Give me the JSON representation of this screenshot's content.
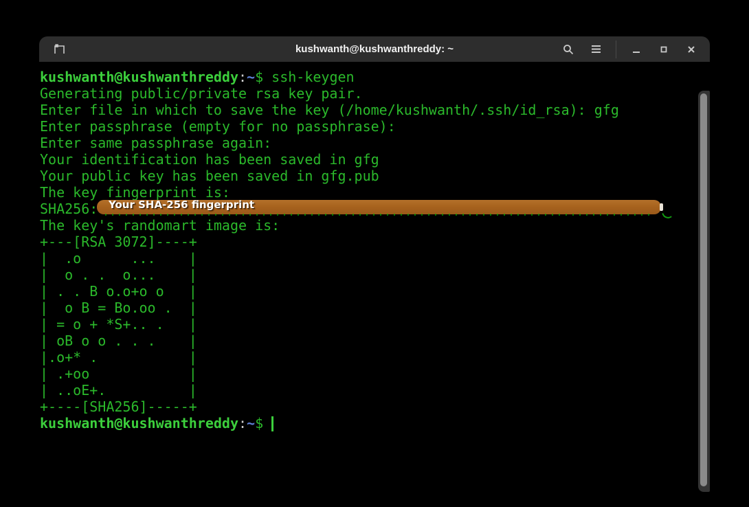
{
  "colors": {
    "background": "#000000",
    "titlebar": "#2d2d2d",
    "title_text": "#f1f1f1",
    "icon": "#c9c9c9",
    "green": "#2bb92b",
    "prompt_green": "#3ccf3c",
    "path_blue": "#5e80d6",
    "plain": "#cdcdcd",
    "redaction_orange": "#a8631e",
    "redaction_text": "#ffffff",
    "scrollbar_thumb": "#8a8a8a",
    "cursor": "#3ccf3c"
  },
  "titlebar": {
    "title": "kushwanth@kushwanthreddy: ~",
    "icon_names": [
      "new-tab-icon",
      "search-icon",
      "menu-icon",
      "minimize-icon",
      "maximize-icon",
      "close-icon"
    ]
  },
  "overlay": {
    "label": "Your SHA-256 fingerprint"
  },
  "terminal": {
    "lines": [
      {
        "segments": [
          {
            "t": "kushwanth@kushwanthreddy",
            "c": "user"
          },
          {
            "t": ":",
            "c": "plain"
          },
          {
            "t": "~",
            "c": "path"
          },
          {
            "t": "$ ",
            "c": "green"
          },
          {
            "t": "ssh-keygen",
            "c": "green"
          }
        ]
      },
      {
        "segments": [
          {
            "t": "Generating public/private rsa key pair.",
            "c": "green"
          }
        ]
      },
      {
        "segments": [
          {
            "t": "Enter file in which to save the key (/home/kushwanth/.ssh/id_rsa): gfg",
            "c": "green"
          }
        ]
      },
      {
        "segments": [
          {
            "t": "Enter passphrase (empty for no passphrase):",
            "c": "green"
          }
        ]
      },
      {
        "segments": [
          {
            "t": "Enter same passphrase again:",
            "c": "green"
          }
        ]
      },
      {
        "segments": [
          {
            "t": "Your identification has been saved in gfg",
            "c": "green"
          }
        ]
      },
      {
        "segments": [
          {
            "t": "Your public key has been saved in gfg.pub",
            "c": "green"
          }
        ]
      },
      {
        "segments": [
          {
            "t": "The key fingerprint is:",
            "c": "green"
          }
        ]
      },
      {
        "segments": [
          {
            "t": "SHA256:",
            "c": "green"
          }
        ]
      },
      {
        "segments": [
          {
            "t": "The key's randomart image is:",
            "c": "green"
          }
        ]
      },
      {
        "segments": [
          {
            "t": "+---[RSA 3072]----+",
            "c": "green"
          }
        ]
      },
      {
        "segments": [
          {
            "t": "|  .o      ...    |",
            "c": "green"
          }
        ]
      },
      {
        "segments": [
          {
            "t": "|  o . .  o...    |",
            "c": "green"
          }
        ]
      },
      {
        "segments": [
          {
            "t": "| . . B o.o+o o   |",
            "c": "green"
          }
        ]
      },
      {
        "segments": [
          {
            "t": "|  o B = Bo.oo .  |",
            "c": "green"
          }
        ]
      },
      {
        "segments": [
          {
            "t": "| = o + *S+.. .   |",
            "c": "green"
          }
        ]
      },
      {
        "segments": [
          {
            "t": "| oB o o . . .    |",
            "c": "green"
          }
        ]
      },
      {
        "segments": [
          {
            "t": "|.o+* .           |",
            "c": "green"
          }
        ]
      },
      {
        "segments": [
          {
            "t": "| .+oo            |",
            "c": "green"
          }
        ]
      },
      {
        "segments": [
          {
            "t": "| ..oE+.          |",
            "c": "green"
          }
        ]
      },
      {
        "segments": [
          {
            "t": "+----[SHA256]-----+",
            "c": "green"
          }
        ]
      },
      {
        "cursor": true,
        "segments": [
          {
            "t": "kushwanth@kushwanthreddy",
            "c": "user"
          },
          {
            "t": ":",
            "c": "plain"
          },
          {
            "t": "~",
            "c": "path"
          },
          {
            "t": "$ ",
            "c": "green"
          }
        ]
      }
    ]
  }
}
